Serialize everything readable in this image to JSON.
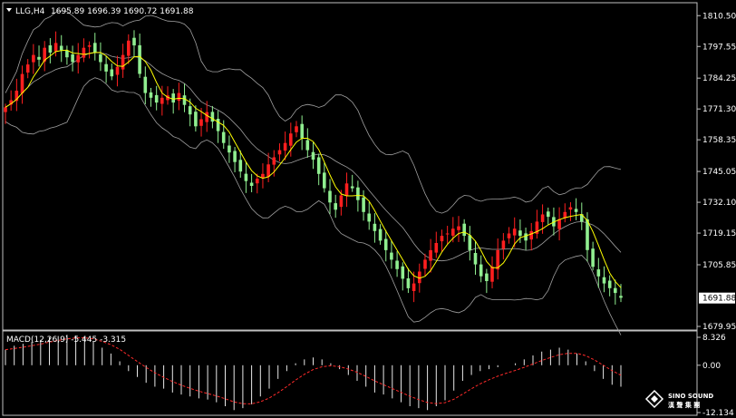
{
  "header": {
    "symbol": "LLG,H4",
    "ohlc": "1695.89 1696.39 1690.72 1691.88"
  },
  "macd": {
    "label": "MACD(12,26,9) -5.445 -3.315",
    "ticks": [
      "8.326",
      "0.00",
      "-12.134"
    ],
    "range": [
      -12.134,
      8.326
    ]
  },
  "price_axis": {
    "ticks": [
      "1810.50",
      "1797.55",
      "1784.25",
      "1771.30",
      "1758.35",
      "1745.05",
      "1732.10",
      "1719.15",
      "1705.85",
      "1679.95"
    ],
    "tick_values": [
      1810.5,
      1797.55,
      1784.25,
      1771.3,
      1758.35,
      1745.05,
      1732.1,
      1719.15,
      1705.85,
      1679.95
    ],
    "range": [
      1679.95,
      1812.5
    ],
    "current_price": "1691.88",
    "current_value": 1691.88
  },
  "logo": {
    "name": "SINO SOUND",
    "subtitle": "漢 聲 集 團"
  },
  "colors": {
    "bull": "#ff1f1f",
    "bear": "#90ee90",
    "ma": "#ffff00",
    "band": "#a0a0a0",
    "signal": "#ff2a2a",
    "grid": "#c0c0c0"
  },
  "chart_data": {
    "type": "candlestick",
    "symbol": "LLG",
    "timeframe": "H4",
    "indicators": [
      "Bollinger Bands",
      "Moving Average",
      "MACD(12,26,9)"
    ],
    "close_series": [
      1772,
      1775,
      1779,
      1786,
      1790,
      1794,
      1792,
      1797,
      1795,
      1799,
      1796,
      1793,
      1791,
      1794,
      1797,
      1798,
      1795,
      1791,
      1787,
      1785,
      1789,
      1794,
      1800,
      1798,
      1786,
      1778,
      1776,
      1774,
      1776,
      1777,
      1774,
      1778,
      1773,
      1769,
      1764,
      1767,
      1770,
      1766,
      1762,
      1757,
      1753,
      1749,
      1745,
      1741,
      1739,
      1742,
      1744,
      1748,
      1751,
      1754,
      1757,
      1761,
      1764,
      1759,
      1754,
      1750,
      1744,
      1738,
      1732,
      1729,
      1735,
      1740,
      1738,
      1733,
      1728,
      1724,
      1720,
      1716,
      1712,
      1708,
      1704,
      1700,
      1696,
      1698,
      1703,
      1708,
      1712,
      1715,
      1718,
      1719,
      1721,
      1722,
      1718,
      1712,
      1706,
      1701,
      1699,
      1705,
      1712,
      1716,
      1719,
      1721,
      1718,
      1716,
      1720,
      1724,
      1727,
      1726,
      1722,
      1725,
      1728,
      1730,
      1728,
      1724,
      1712,
      1705,
      1701,
      1698,
      1696,
      1694,
      1692
    ],
    "macd_histogram": [
      4.0,
      5.0,
      5.5,
      6.0,
      6.5,
      7.2,
      7.5,
      7.8,
      7.6,
      7.2,
      6.0,
      4.5,
      3.0,
      1.0,
      -1.5,
      -3.0,
      -4.5,
      -5.5,
      -6.0,
      -7.0,
      -7.5,
      -8.0,
      -8.5,
      -8.8,
      -9.5,
      -10.5,
      -11.5,
      -11.0,
      -10.0,
      -8.0,
      -6.0,
      -3.5,
      -1.5,
      0.5,
      1.5,
      2.0,
      1.5,
      0.5,
      -1.0,
      -2.5,
      -4.0,
      -5.5,
      -7.0,
      -7.5,
      -8.5,
      -9.5,
      -10.5,
      -11.0,
      -11.5,
      -10.5,
      -9.0,
      -6.5,
      -4.0,
      -2.5,
      -1.5,
      -1.0,
      -0.5,
      0.0,
      0.5,
      1.5,
      2.5,
      3.5,
      4.0,
      4.5,
      4.0,
      3.0,
      1.0,
      -1.5,
      -3.5,
      -5.0,
      -5.5
    ]
  }
}
